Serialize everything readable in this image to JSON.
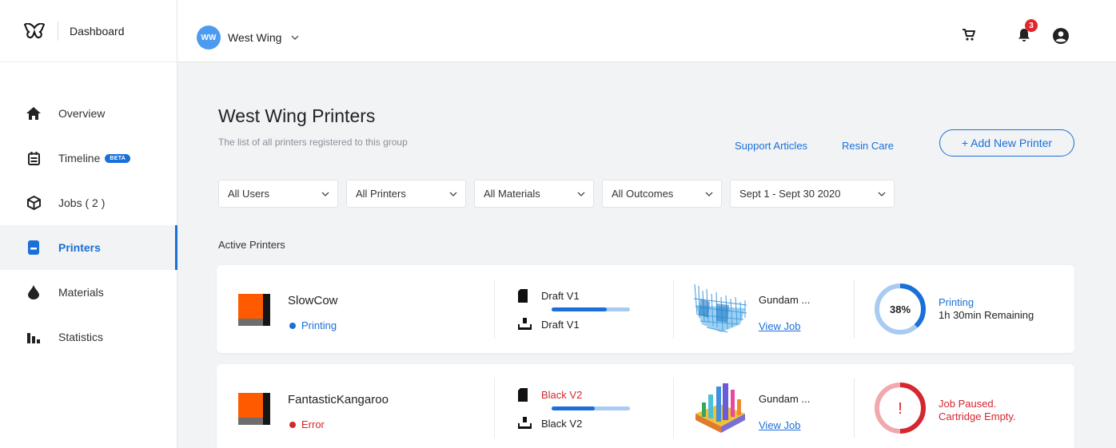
{
  "sidebar": {
    "brand_label": "Dashboard",
    "items": [
      {
        "label": "Overview",
        "icon": "home-icon"
      },
      {
        "label": "Timeline",
        "badge": "BETA",
        "icon": "calendar-icon"
      },
      {
        "label": "Jobs  ( 2 )",
        "icon": "cube-icon"
      },
      {
        "label": "Printers",
        "icon": "printer-icon",
        "active": true
      },
      {
        "label": "Materials",
        "icon": "drop-icon"
      },
      {
        "label": "Statistics",
        "icon": "bar-chart-icon"
      }
    ]
  },
  "topbar": {
    "avatar_initials": "WW",
    "group_name": "West Wing",
    "notification_count": "3"
  },
  "main": {
    "title": "West Wing Printers",
    "subtitle": "The list of all printers registered to this group",
    "links": {
      "support": "Support Articles",
      "resin": "Resin Care"
    },
    "add_button": "+ Add New Printer",
    "filters": [
      "All Users",
      "All Printers",
      "All Materials",
      "All Outcomes",
      "Sept 1 - Sept 30 2020"
    ],
    "section_label": "Active Printers",
    "printers": [
      {
        "name": "SlowCow",
        "status": "Printing",
        "status_color": "#1a6fd9",
        "material_loaded": "Draft V1",
        "material_tray": "Draft V1",
        "material_fill": 0.7,
        "job_name": "Gundam ...",
        "view_job": "View Job",
        "progress_label": "38%",
        "progress_value": 0.38,
        "state_line1": "Printing",
        "state_line2": "1h 30min Remaining"
      },
      {
        "name": "FantasticKangaroo",
        "status": "Error",
        "status_color": "#d6262e",
        "material_loaded": "Black V2",
        "material_tray": "Black V2",
        "material_fill": 0.55,
        "job_name": "Gundam ...",
        "view_job": "View Job",
        "progress_label": "!",
        "state_line1": "Job Paused.",
        "state_line2": "Cartridge Empty."
      }
    ]
  },
  "colors": {
    "accent": "#1a6fd9",
    "error": "#d6262e",
    "thumb_orange": "#ff5a00"
  }
}
